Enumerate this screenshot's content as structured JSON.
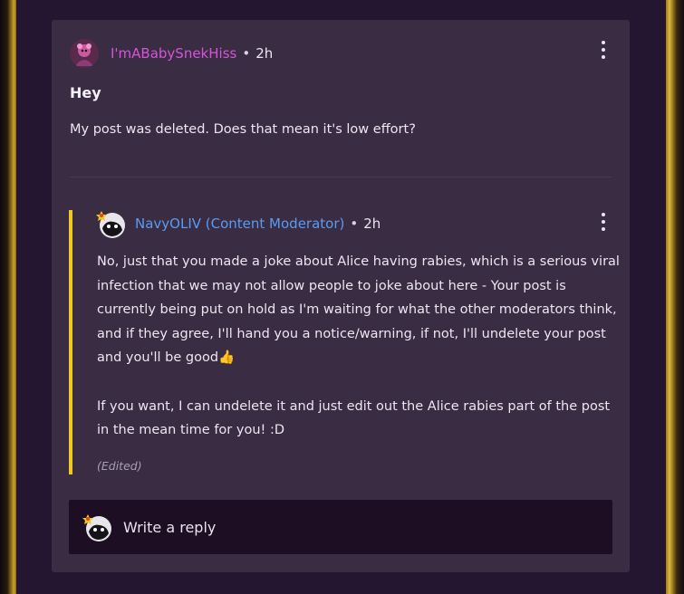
{
  "post": {
    "author": "I'mABabySnekHiss",
    "separator": "•",
    "time": "2h",
    "title": "Hey",
    "body": "My post was deleted. Does that mean it's low effort?"
  },
  "reply": {
    "author": "NavyOLIV (Content Moderator)",
    "separator": "•",
    "time": "2h",
    "paragraphs": [
      "No, just that you made a joke about Alice having rabies, which is a serious viral infection that we may not allow people to joke about here - Your post is currently being put on hold as I'm waiting for what the other moderators think, and if they agree, I'll hand you a notice/warning, if not, I'll undelete your post and you'll be good👍",
      "If you want, I can undelete it and just edit out the Alice rabies part of the post in the mean time for you! :D"
    ],
    "edited_label": "(Edited)"
  },
  "composer": {
    "placeholder": "Write a reply"
  },
  "colors": {
    "author_accent": "#d455d8",
    "moderator_accent": "#5a9bf0",
    "reply_bar": "#f0c81e"
  }
}
